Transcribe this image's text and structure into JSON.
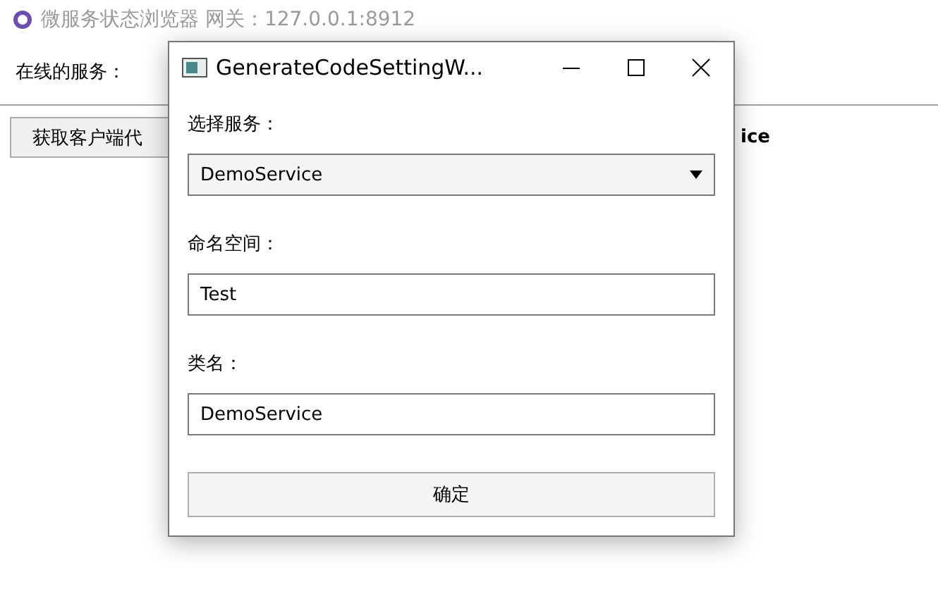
{
  "main_window": {
    "title": "微服务状态浏览器 网关：127.0.0.1:8912",
    "services_label": "在线的服务：",
    "client_code_button": "获取客户端代",
    "service_name": "ice"
  },
  "dialog": {
    "title": "GenerateCodeSettingW...",
    "fields": [
      {
        "kind": "select",
        "label": "选择服务：",
        "value": "DemoService"
      },
      {
        "kind": "text",
        "label": "命名空间：",
        "value": "Test"
      },
      {
        "kind": "text",
        "label": "类名：",
        "value": "DemoService"
      }
    ],
    "confirm_button": "确定"
  }
}
